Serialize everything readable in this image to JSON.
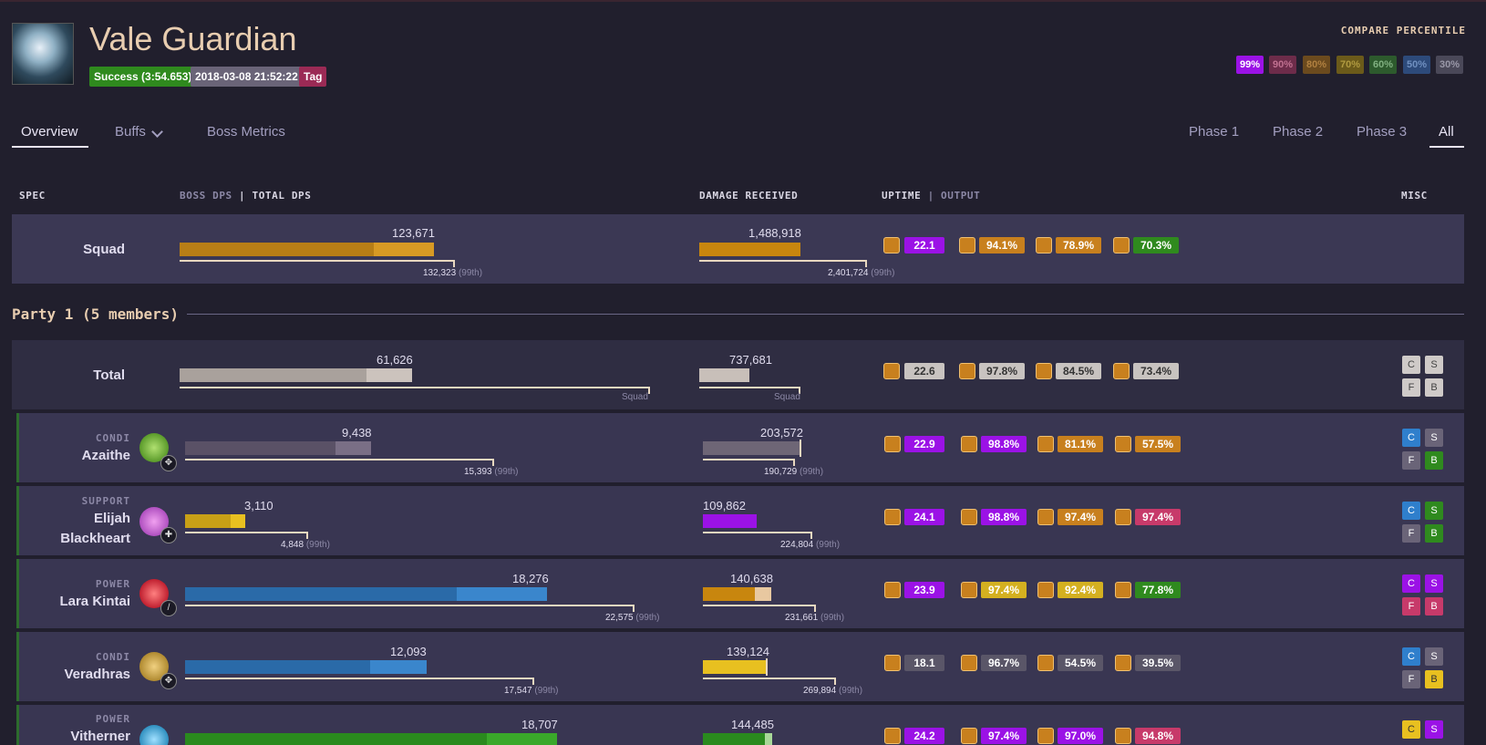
{
  "header": {
    "boss_name": "Vale Guardian",
    "badges": [
      {
        "label": "Success (3:54.653)",
        "color": "#2f8a1e"
      },
      {
        "label": "2018-03-08 21:52:22",
        "color": "#6a6478"
      },
      {
        "label": "Tag",
        "color": "#9b2a55"
      }
    ]
  },
  "compare": {
    "title": "COMPARE PERCENTILE",
    "options": [
      {
        "label": "99%",
        "bg": "#9b12e6",
        "fg": "#ffffff"
      },
      {
        "label": "90%",
        "bg": "#6d2c4a",
        "fg": "#c07090"
      },
      {
        "label": "80%",
        "bg": "#6b4a1e",
        "fg": "#b08040"
      },
      {
        "label": "70%",
        "bg": "#6b5a1a",
        "fg": "#b09a40"
      },
      {
        "label": "60%",
        "bg": "#2d5a2d",
        "fg": "#80b080"
      },
      {
        "label": "50%",
        "bg": "#2d4a7a",
        "fg": "#7090c0"
      },
      {
        "label": "30%",
        "bg": "#4a4858",
        "fg": "#9a98a8"
      }
    ]
  },
  "tabs": {
    "left": [
      "Overview",
      "Buffs",
      "Boss Metrics"
    ],
    "right": [
      "Phase 1",
      "Phase 2",
      "Phase 3",
      "All"
    ]
  },
  "columns": {
    "spec": "SPEC",
    "boss_dps": "BOSS DPS",
    "sep": "|",
    "total_dps": "TOTAL DPS",
    "damage_received": "DAMAGE RECEIVED",
    "uptime": "UPTIME",
    "output": "OUTPUT",
    "misc": "MISC"
  },
  "squad": {
    "label": "Squad",
    "dps": {
      "value": "123,671",
      "ref": "132,323",
      "ref_pct": "(99th)"
    },
    "dmg": {
      "value": "1,488,918",
      "ref": "2,401,724",
      "ref_pct": "(99th)"
    },
    "boons": [
      {
        "value": "22.1",
        "color": "#9b12e6"
      },
      {
        "value": "94.1%",
        "color": "#c8801e"
      },
      {
        "value": "78.9%",
        "color": "#c8801e"
      },
      {
        "value": "70.3%",
        "color": "#2f8a1e"
      }
    ]
  },
  "party": {
    "title": "Party 1 (5 members)",
    "total": {
      "label": "Total",
      "dps": {
        "value": "61,626",
        "ref": "Squad"
      },
      "dmg": {
        "value": "737,681",
        "ref": "Squad"
      },
      "boons": [
        {
          "value": "22.6",
          "color": "#c8c3c0",
          "fg": "#333"
        },
        {
          "value": "97.8%",
          "color": "#c8c3c0",
          "fg": "#333"
        },
        {
          "value": "84.5%",
          "color": "#c8c3c0",
          "fg": "#333"
        },
        {
          "value": "73.4%",
          "color": "#c8c3c0",
          "fg": "#333"
        }
      ],
      "misc": [
        "C",
        "S",
        "F",
        "B"
      ]
    },
    "members": [
      {
        "role": "CONDI",
        "name": "Azaithe",
        "name2": "",
        "dps": {
          "value": "9,438",
          "ref": "15,393",
          "ref_pct": "(99th)"
        },
        "dmg": {
          "value": "203,572",
          "ref": "190,729",
          "ref_pct": "(99th)"
        },
        "boons": [
          {
            "value": "22.9",
            "color": "#9b12e6"
          },
          {
            "value": "98.8%",
            "color": "#9b12e6"
          },
          {
            "value": "81.1%",
            "color": "#c8801e"
          },
          {
            "value": "57.5%",
            "color": "#c8801e"
          }
        ],
        "misc": [
          "C",
          "S",
          "F",
          "B"
        ]
      },
      {
        "role": "SUPPORT",
        "name": "Elijah",
        "name2": "Blackheart",
        "dps": {
          "value": "3,110",
          "ref": "4,848",
          "ref_pct": "(99th)"
        },
        "dmg": {
          "value": "109,862",
          "ref": "224,804",
          "ref_pct": "(99th)"
        },
        "boons": [
          {
            "value": "24.1",
            "color": "#9b12e6"
          },
          {
            "value": "98.8%",
            "color": "#9b12e6"
          },
          {
            "value": "97.4%",
            "color": "#c8801e"
          },
          {
            "value": "97.4%",
            "color": "#c73a6a"
          }
        ],
        "misc": [
          "C",
          "S",
          "F",
          "B"
        ]
      },
      {
        "role": "POWER",
        "name": "Lara Kintai",
        "name2": "",
        "dps": {
          "value": "18,276",
          "ref": "22,575",
          "ref_pct": "(99th)"
        },
        "dmg": {
          "value": "140,638",
          "ref": "231,661",
          "ref_pct": "(99th)"
        },
        "boons": [
          {
            "value": "23.9",
            "color": "#9b12e6"
          },
          {
            "value": "97.4%",
            "color": "#d4b020"
          },
          {
            "value": "92.4%",
            "color": "#d4b020"
          },
          {
            "value": "77.8%",
            "color": "#2f8a1e"
          }
        ],
        "misc": [
          "C",
          "S",
          "F",
          "B"
        ]
      },
      {
        "role": "CONDI",
        "name": "Veradhras",
        "name2": "",
        "dps": {
          "value": "12,093",
          "ref": "17,547",
          "ref_pct": "(99th)"
        },
        "dmg": {
          "value": "139,124",
          "ref": "269,894",
          "ref_pct": "(99th)"
        },
        "boons": [
          {
            "value": "18.1",
            "color": "#5a5668"
          },
          {
            "value": "96.7%",
            "color": "#5a5668"
          },
          {
            "value": "54.5%",
            "color": "#5a5668"
          },
          {
            "value": "39.5%",
            "color": "#5a5668"
          }
        ],
        "misc": [
          "C",
          "S",
          "F",
          "B"
        ]
      },
      {
        "role": "POWER",
        "name": "Vitherner",
        "name2": "",
        "dps": {
          "value": "18,707",
          "ref": "",
          "ref_pct": ""
        },
        "dmg": {
          "value": "144,485",
          "ref": "",
          "ref_pct": ""
        },
        "boons": [
          {
            "value": "24.2",
            "color": "#9b12e6"
          },
          {
            "value": "97.4%",
            "color": "#9b12e6"
          },
          {
            "value": "97.0%",
            "color": "#9b12e6"
          },
          {
            "value": "94.8%",
            "color": "#c73a6a"
          }
        ],
        "misc": [
          "C",
          "S",
          "F",
          "B"
        ]
      }
    ]
  }
}
